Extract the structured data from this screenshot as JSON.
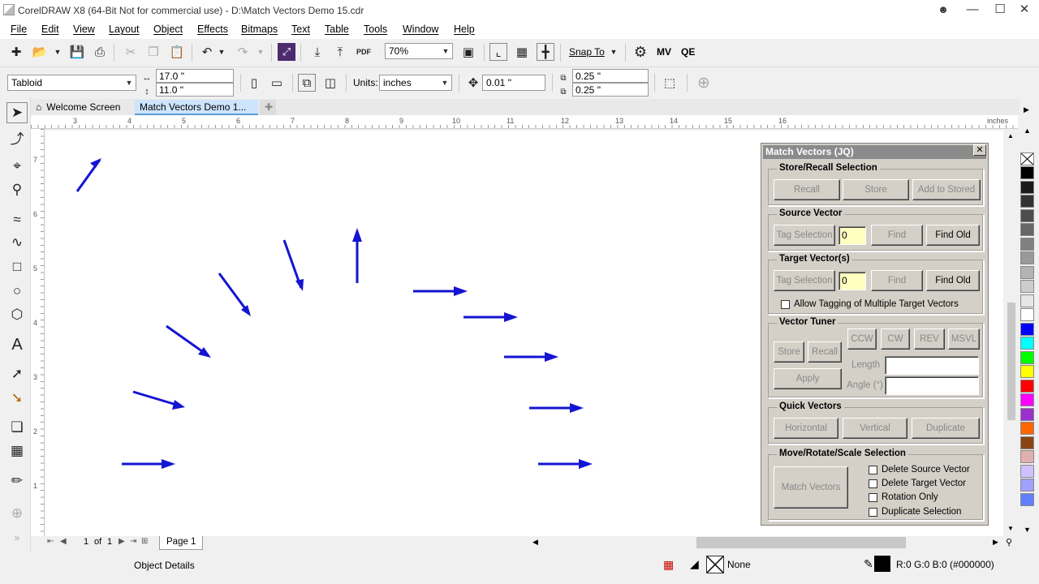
{
  "window": {
    "title": "CorelDRAW X8 (64-Bit Not for commercial use) - D:\\Match Vectors Demo 15.cdr"
  },
  "menu": [
    "File",
    "Edit",
    "View",
    "Layout",
    "Object",
    "Effects",
    "Bitmaps",
    "Text",
    "Table",
    "Tools",
    "Window",
    "Help"
  ],
  "toolbar": {
    "zoom": "70%",
    "snap_to": "Snap To",
    "mv": "MV",
    "qe": "QE"
  },
  "propbar": {
    "paper": "Tabloid",
    "width": "17.0 \"",
    "height": "11.0 \"",
    "units_label": "Units:",
    "units": "inches",
    "nudge": "0.01 \"",
    "dup_x": "0.25 \"",
    "dup_y": "0.25 \""
  },
  "tabs": {
    "welcome": "Welcome Screen",
    "doc": "Match Vectors Demo 1..."
  },
  "ruler": {
    "h_ticks": [
      "3",
      "4",
      "5",
      "6",
      "7",
      "8",
      "9",
      "10",
      "11",
      "12",
      "13",
      "14",
      "15",
      "16"
    ],
    "units": "inches",
    "v_ticks": [
      "7",
      "6",
      "5",
      "4",
      "3",
      "2",
      "1"
    ]
  },
  "pagebar": {
    "current": "1",
    "of": "of",
    "total": "1",
    "page_tab": "Page 1"
  },
  "docker": {
    "title": "Match Vectors (JQ)",
    "store_recall": {
      "title": "Store/Recall Selection",
      "recall": "Recall",
      "store": "Store",
      "add": "Add to Stored"
    },
    "source": {
      "title": "Source Vector",
      "tag": "Tag Selection",
      "value": "0",
      "find": "Find",
      "find_old": "Find Old"
    },
    "target": {
      "title": "Target Vector(s)",
      "tag": "Tag Selection",
      "value": "0",
      "find": "Find",
      "find_old": "Find Old",
      "allow_multi": "Allow Tagging of Multiple Target Vectors"
    },
    "tuner": {
      "title": "Vector Tuner",
      "ccw": "CCW",
      "cw": "CW",
      "rev": "REV",
      "msvl": "MSVL",
      "store": "Store",
      "recall": "Recall",
      "apply": "Apply",
      "length": "Length",
      "angle": "Angle (°)"
    },
    "quick": {
      "title": "Quick Vectors",
      "horizontal": "Horizontal",
      "vertical": "Vertical",
      "duplicate": "Duplicate"
    },
    "move": {
      "title": "Move/Rotate/Scale Selection",
      "match": "Match Vectors",
      "del_source": "Delete Source Vector",
      "del_target": "Delete Target Vector",
      "rotation_only": "Rotation Only",
      "dup_sel": "Duplicate Selection"
    }
  },
  "status": {
    "object_details": "Object Details",
    "fill": "None",
    "outline": "R:0 G:0 B:0 (#000000)"
  },
  "colors": {
    "arrow": "#1414d2",
    "docker_bg": "#d4d0c8",
    "yellow_input": "#ffffc0"
  },
  "palette": [
    "#ffffff",
    "#000000",
    "#1a1a1a",
    "#333333",
    "#4d4d4d",
    "#666666",
    "#808080",
    "#999999",
    "#b3b3b3",
    "#cccccc",
    "#e6e6e6",
    "#ffffff",
    "#0000ff",
    "#00ffff",
    "#00ff00",
    "#ffff00",
    "#ff0000",
    "#ff00ff",
    "#9932cc",
    "#ff6600",
    "#8b4513",
    "#e0b0b0",
    "#d0c0ff",
    "#a0a0ff",
    "#6080ff"
  ]
}
